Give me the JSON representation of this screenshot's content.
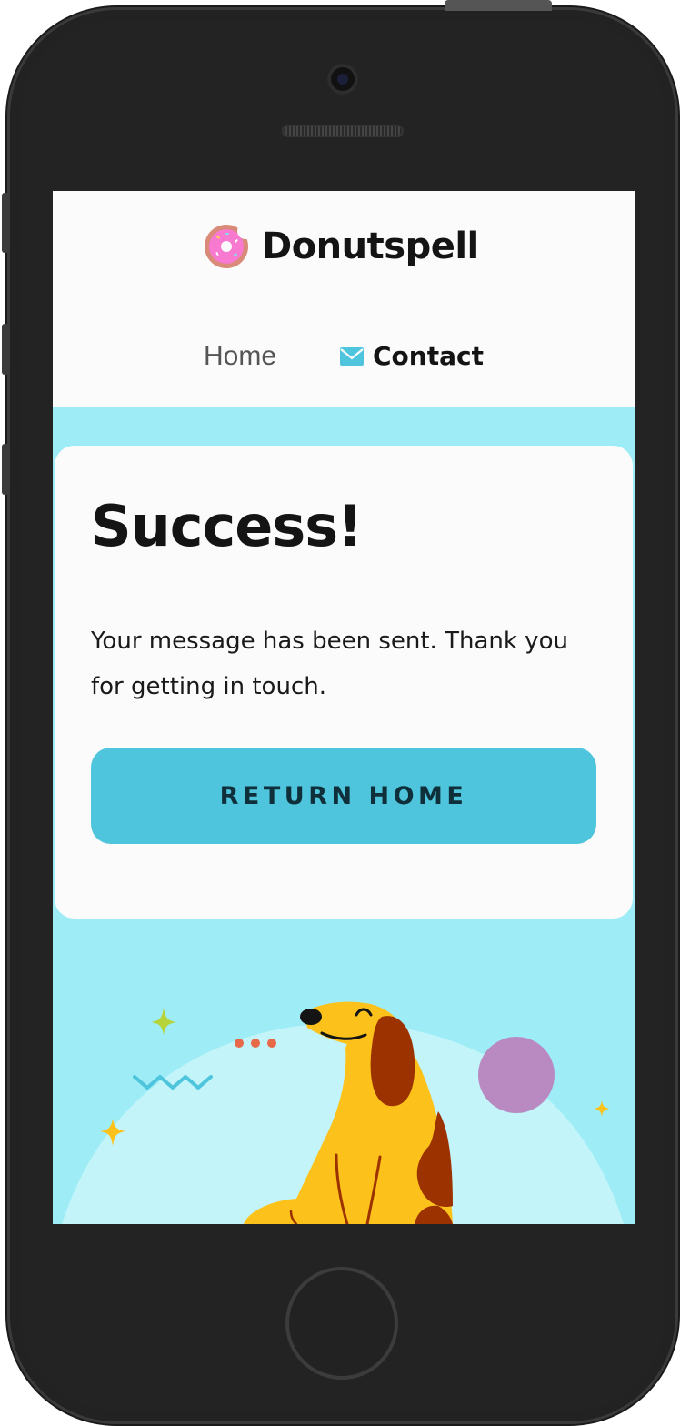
{
  "app": {
    "brand_name": "Donutspell",
    "logo_icon": "donut-icon"
  },
  "nav": {
    "home_label": "Home",
    "contact_label": "Contact",
    "contact_icon": "envelope-icon"
  },
  "card": {
    "title": "Success!",
    "message": "Your message has been sent. Thank you for getting in touch.",
    "button_label": "RETURN HOME"
  },
  "colors": {
    "background": "#9eedf6",
    "accent_button": "#4ec5dc",
    "dog_body": "#fcc21b",
    "dog_spots": "#9c3200",
    "planet": "#b98ac2",
    "sparkle_yellow": "#fcc21b",
    "sparkle_green": "#b6d43a",
    "dots": "#e8684a"
  }
}
